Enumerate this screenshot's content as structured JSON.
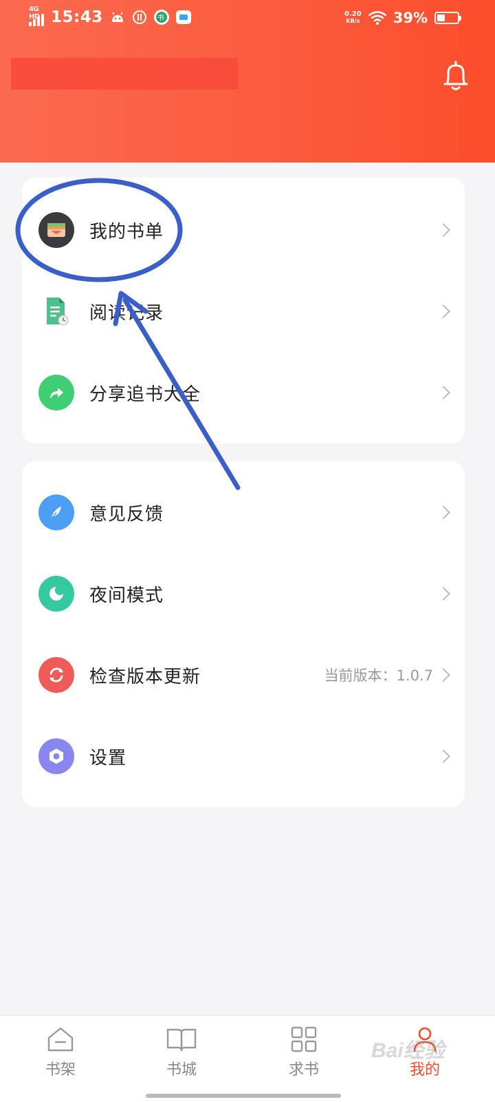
{
  "status_bar": {
    "network": "4G HD",
    "time": "15:43",
    "speed_value": "0.20",
    "speed_unit": "KB/s",
    "battery": "39%",
    "battery_level": 0.39
  },
  "menu_group_1": [
    {
      "label": "我的书单",
      "icon": "book-list-icon"
    },
    {
      "label": "阅读记录",
      "icon": "reading-record-icon"
    },
    {
      "label": "分享追书大全",
      "icon": "share-icon"
    }
  ],
  "menu_group_2": [
    {
      "label": "意见反馈",
      "icon": "feedback-icon"
    },
    {
      "label": "夜间模式",
      "icon": "night-mode-icon"
    },
    {
      "label": "检查版本更新",
      "icon": "update-icon",
      "extra": "当前版本：1.0.7"
    },
    {
      "label": "设置",
      "icon": "settings-icon"
    }
  ],
  "bottom_nav": [
    {
      "label": "书架",
      "icon": "bookshelf-icon"
    },
    {
      "label": "书城",
      "icon": "bookstore-icon"
    },
    {
      "label": "求书",
      "icon": "request-book-icon"
    },
    {
      "label": "我的",
      "icon": "profile-icon",
      "active": true
    }
  ],
  "colors": {
    "header_gradient_start": "#fb6a4f",
    "header_gradient_end": "#fc4d2b",
    "accent": "#f24d2b",
    "annotation_blue": "#3b5fc8"
  }
}
